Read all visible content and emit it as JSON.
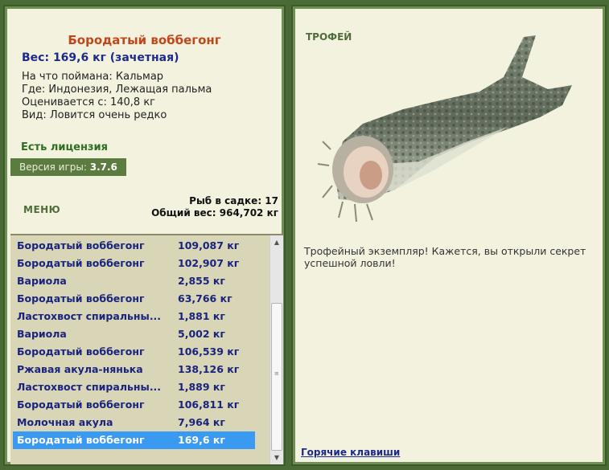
{
  "fish": {
    "name": "Бородатый воббегонг",
    "weight": "Вес: 169,6 кг (зачетная)",
    "bait": "На что поймана: Кальмар",
    "location": "Где: Индонезия, Лежащая пальма",
    "estimated": "Оценивается с: 140,8 кг",
    "rarity": "Вид: Ловится очень редко"
  },
  "license": "Есть лицензия",
  "version": {
    "label": "Версия игры: ",
    "value": "3.7.6"
  },
  "menu_label": "МЕНЮ",
  "stats": {
    "fish_in_keepnet": "Рыб в садке: 17",
    "total_weight": "Общий вес: 964,702 кг"
  },
  "catch_list": [
    {
      "name": "Бородатый воббегонг",
      "weight": "109,087 кг"
    },
    {
      "name": "Бородатый воббегонг",
      "weight": "102,907 кг"
    },
    {
      "name": "Вариола",
      "weight": "2,855 кг"
    },
    {
      "name": "Бородатый воббегонг",
      "weight": "63,766 кг"
    },
    {
      "name": "Ластохвост спиральны...",
      "weight": "1,881 кг"
    },
    {
      "name": "Вариола",
      "weight": "5,002 кг"
    },
    {
      "name": "Бородатый воббегонг",
      "weight": "106,539 кг"
    },
    {
      "name": "Ржавая акула-нянька",
      "weight": "138,126 кг"
    },
    {
      "name": "Ластохвост спиральны...",
      "weight": "1,889 кг"
    },
    {
      "name": "Бородатый воббегонг",
      "weight": "106,811 кг"
    },
    {
      "name": "Молочная акула",
      "weight": "7,964 кг"
    },
    {
      "name": "Бородатый воббегонг",
      "weight": "169,6 кг",
      "selected": true
    }
  ],
  "trophy": {
    "label": "ТРОФЕЙ",
    "text": "Трофейный экземпляр! Кажется, вы открыли секрет успешной ловли!"
  },
  "hotkeys_label": "Горячие клавиши",
  "colors": {
    "frame": "#4a6b35",
    "panel_bg": "#f3f2df",
    "title": "#c0471a",
    "weight": "#1e2a8a",
    "license": "#2e6e1e",
    "selection": "#3a9af2"
  }
}
